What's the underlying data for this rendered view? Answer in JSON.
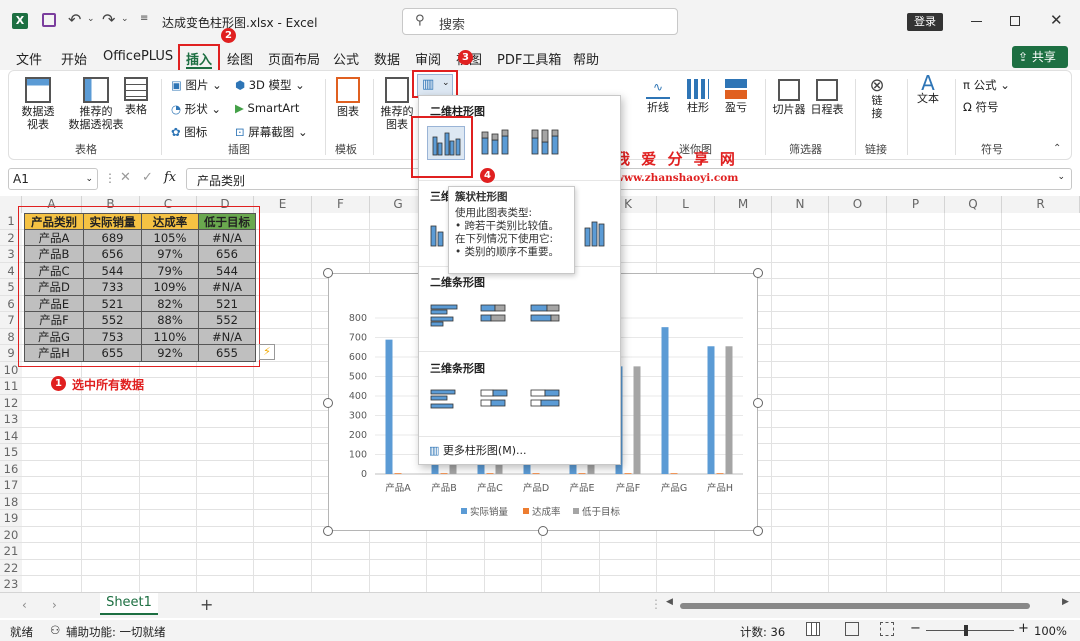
{
  "titlebar": {
    "file_name": "达成变色柱形图.xlsx",
    "separator": "-",
    "app": "Excel",
    "search_placeholder": "搜索",
    "login": "登录"
  },
  "menu": {
    "items": [
      "文件",
      "开始",
      "OfficePLUS",
      "插入",
      "绘图",
      "页面布局",
      "公式",
      "数据",
      "审阅",
      "视图",
      "PDF工具箱",
      "帮助"
    ],
    "share": "共享"
  },
  "ribbon": {
    "table_group": {
      "pivot": "数据透\n视表",
      "recommended_pivot": "推荐的\n数据透视表",
      "table": "表格",
      "label": "表格"
    },
    "illus_group": {
      "picture": "图片",
      "shape": "形状",
      "icon": "图标",
      "model3d": "3D 模型",
      "smartart": "SmartArt",
      "screenshot": "屏幕截图",
      "label": "插图"
    },
    "template_group": {
      "chart": "图表",
      "label": "模板"
    },
    "charts_group": {
      "recommended": "推荐的\n图表"
    },
    "sparkline_group": {
      "line": "折线",
      "column": "柱形",
      "winloss": "盈亏",
      "label": "迷你图"
    },
    "filter_group": {
      "slicer": "切片器",
      "timeline": "日程表",
      "label": "筛选器"
    },
    "link_group": {
      "link": "链\n接",
      "label": "链接"
    },
    "text_group": {
      "text": "文本"
    },
    "symbol_group": {
      "formula": "公式",
      "symbol": "符号",
      "label": "符号"
    }
  },
  "formula_bar": {
    "name_box": "A1",
    "fx": "fx",
    "content": "产品类别"
  },
  "columns": [
    "A",
    "B",
    "C",
    "D",
    "E",
    "F",
    "G",
    "H",
    "I",
    "J",
    "K",
    "L",
    "M",
    "N",
    "O",
    "P",
    "Q",
    "R"
  ],
  "rows": [
    "1",
    "2",
    "3",
    "4",
    "5",
    "6",
    "7",
    "8",
    "9",
    "10",
    "11",
    "12",
    "13",
    "14",
    "15",
    "16",
    "17",
    "18",
    "19",
    "20",
    "21",
    "22",
    "23"
  ],
  "table": {
    "headers": [
      "产品类别",
      "实际销量",
      "达成率",
      "低于目标"
    ],
    "rows": [
      [
        "产品A",
        "689",
        "105%",
        "#N/A"
      ],
      [
        "产品B",
        "656",
        "97%",
        "656"
      ],
      [
        "产品C",
        "544",
        "79%",
        "544"
      ],
      [
        "产品D",
        "733",
        "109%",
        "#N/A"
      ],
      [
        "产品E",
        "521",
        "82%",
        "521"
      ],
      [
        "产品F",
        "552",
        "88%",
        "552"
      ],
      [
        "产品G",
        "753",
        "110%",
        "#N/A"
      ],
      [
        "产品H",
        "655",
        "92%",
        "655"
      ]
    ]
  },
  "annotations": {
    "step1": "选中所有数据",
    "num1": "1",
    "num2": "2",
    "num3": "3",
    "num4": "4"
  },
  "watermark": {
    "title": "我 爱 分 享 网",
    "url": "www.zhanshaoyi.com"
  },
  "dropdown": {
    "header_2d_column": "二维柱形图",
    "header_3d_column": "三维柱形图",
    "header_2d_bar": "二维条形图",
    "header_3d_bar": "三维条形图",
    "more": "更多柱形图(M)..."
  },
  "tooltip": {
    "title": "簇状柱形图",
    "line1": "使用此图表类型:",
    "line2": "• 跨若干类别比较值。",
    "line3": "在下列情况下使用它:",
    "line4": "• 类别的顺序不重要。"
  },
  "chart_data": {
    "type": "bar",
    "categories": [
      "产品A",
      "产品B",
      "产品C",
      "产品D",
      "产品E",
      "产品F",
      "产品G",
      "产品H"
    ],
    "series": [
      {
        "name": "实际销量",
        "color": "#5b9bd5",
        "values": [
          689,
          656,
          544,
          733,
          521,
          552,
          753,
          655
        ]
      },
      {
        "name": "达成率",
        "color": "#ed7d31",
        "values": [
          1.05,
          0.97,
          0.79,
          1.09,
          0.82,
          0.88,
          1.1,
          0.92
        ]
      },
      {
        "name": "低于目标",
        "color": "#a5a5a5",
        "values": [
          null,
          656,
          544,
          null,
          521,
          552,
          null,
          655
        ]
      }
    ],
    "yticks": [
      "0",
      "100",
      "200",
      "300",
      "400",
      "500",
      "600",
      "700",
      "800"
    ],
    "ylim": [
      0,
      800
    ],
    "legend": "bottom"
  },
  "sheetbar": {
    "tab": "Sheet1",
    "add": "+"
  },
  "status": {
    "ready": "就绪",
    "accessibility": "辅助功能: 一切就绪",
    "count": "计数: 36",
    "zoom": "100%"
  },
  "colors": {
    "excel_green": "#217346",
    "header_yellow": "#f5c243",
    "header_green": "#6aa84f",
    "cell_gray": "#bfbfbf",
    "red": "#e02020"
  }
}
